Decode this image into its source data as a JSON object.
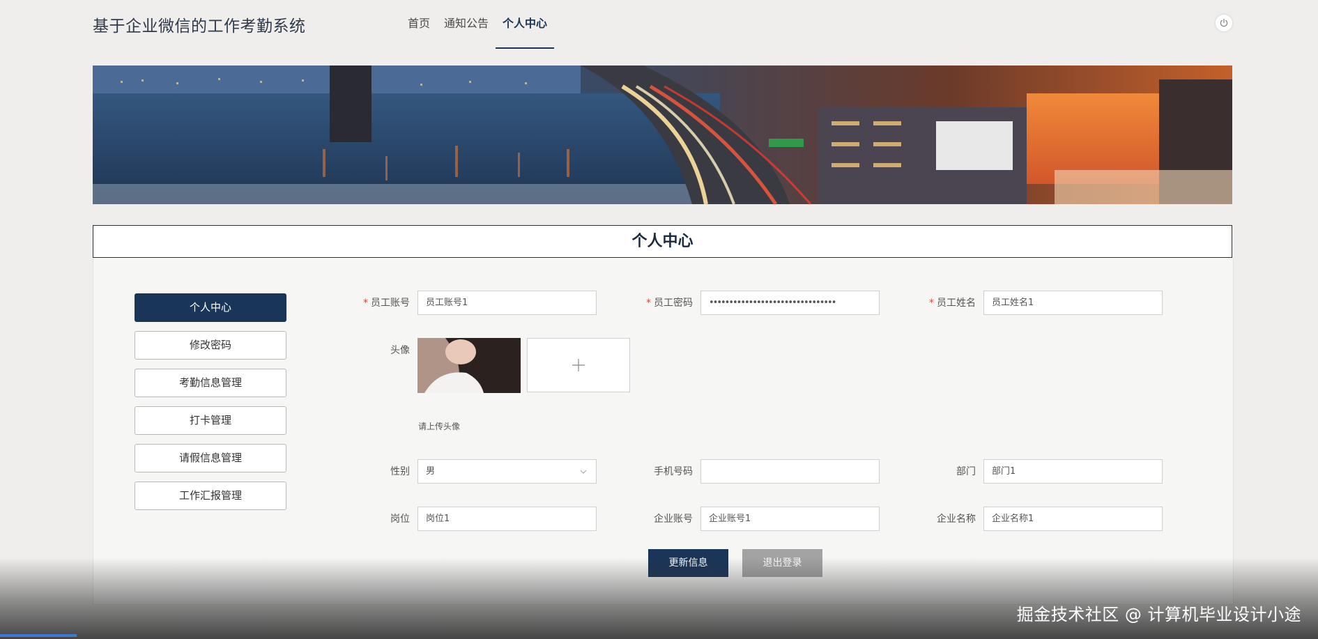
{
  "header": {
    "site_title": "基于企业微信的工作考勤系统",
    "nav": [
      {
        "label": "首页",
        "active": false
      },
      {
        "label": "通知公告",
        "active": false
      },
      {
        "label": "个人中心",
        "active": true
      }
    ],
    "logout_icon": "power-icon"
  },
  "section_title": "个人中心",
  "sidebar": {
    "items": [
      {
        "label": "个人中心",
        "active": true
      },
      {
        "label": "修改密码",
        "active": false
      },
      {
        "label": "考勤信息管理",
        "active": false
      },
      {
        "label": "打卡管理",
        "active": false
      },
      {
        "label": "请假信息管理",
        "active": false
      },
      {
        "label": "工作汇报管理",
        "active": false
      }
    ]
  },
  "form": {
    "employee_account": {
      "label": "员工账号",
      "required": true,
      "value": "员工账号1"
    },
    "employee_password": {
      "label": "员工密码",
      "required": true,
      "value": "••••••••••••••••••••••••••••••••"
    },
    "employee_name": {
      "label": "员工姓名",
      "required": true,
      "value": "员工姓名1"
    },
    "avatar": {
      "label": "头像",
      "hint": "请上传头像",
      "upload_icon": "plus-icon"
    },
    "gender": {
      "label": "性别",
      "value": "男"
    },
    "phone": {
      "label": "手机号码",
      "value": ""
    },
    "department": {
      "label": "部门",
      "value": "部门1"
    },
    "position": {
      "label": "岗位",
      "value": "岗位1"
    },
    "company_account": {
      "label": "企业账号",
      "value": "企业账号1"
    },
    "company_name": {
      "label": "企业名称",
      "value": "企业名称1"
    }
  },
  "buttons": {
    "update": "更新信息",
    "logout": "退出登录"
  },
  "watermark": "掘金技术社区 @ 计算机毕业设计小途",
  "colors": {
    "primary": "#193557",
    "secondary_button": "#a3a3a3",
    "background": "#efeeec"
  }
}
